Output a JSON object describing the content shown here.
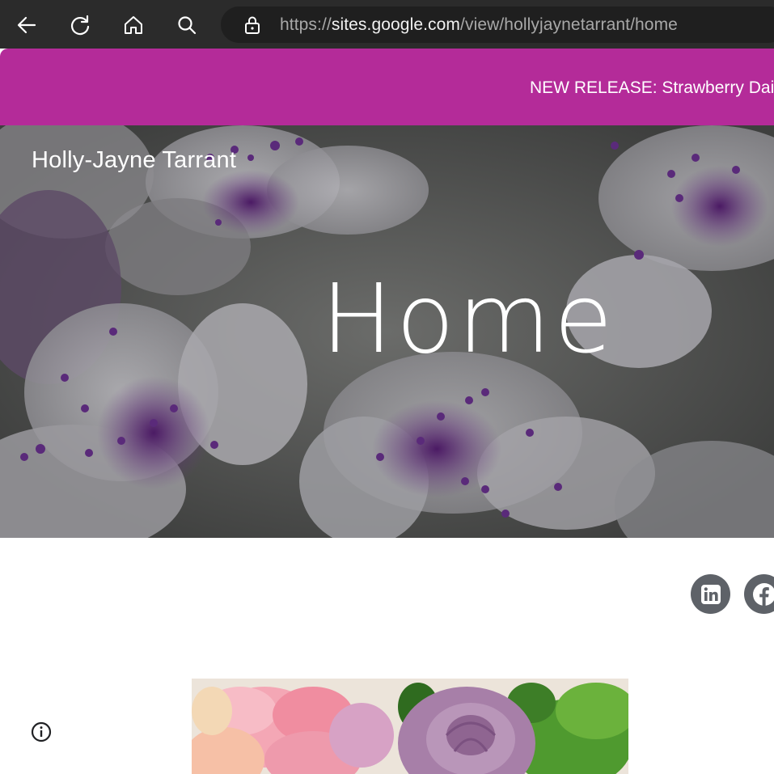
{
  "browser": {
    "url_scheme": "https://",
    "url_host": "sites.google.com",
    "url_path": "/view/hollyjaynetarrant/home"
  },
  "banner": {
    "text": "NEW RELEASE: Strawberry Dai"
  },
  "site": {
    "title": "Holly-Jayne Tarrant"
  },
  "hero": {
    "page_title": "Home"
  },
  "social": {
    "items": [
      {
        "name": "linkedin-icon",
        "label": "in"
      },
      {
        "name": "facebook-icon",
        "label": "f"
      }
    ]
  },
  "colors": {
    "toolbar": "#2b2b2b",
    "banner": "#b42b99",
    "social": "#5e6268"
  }
}
